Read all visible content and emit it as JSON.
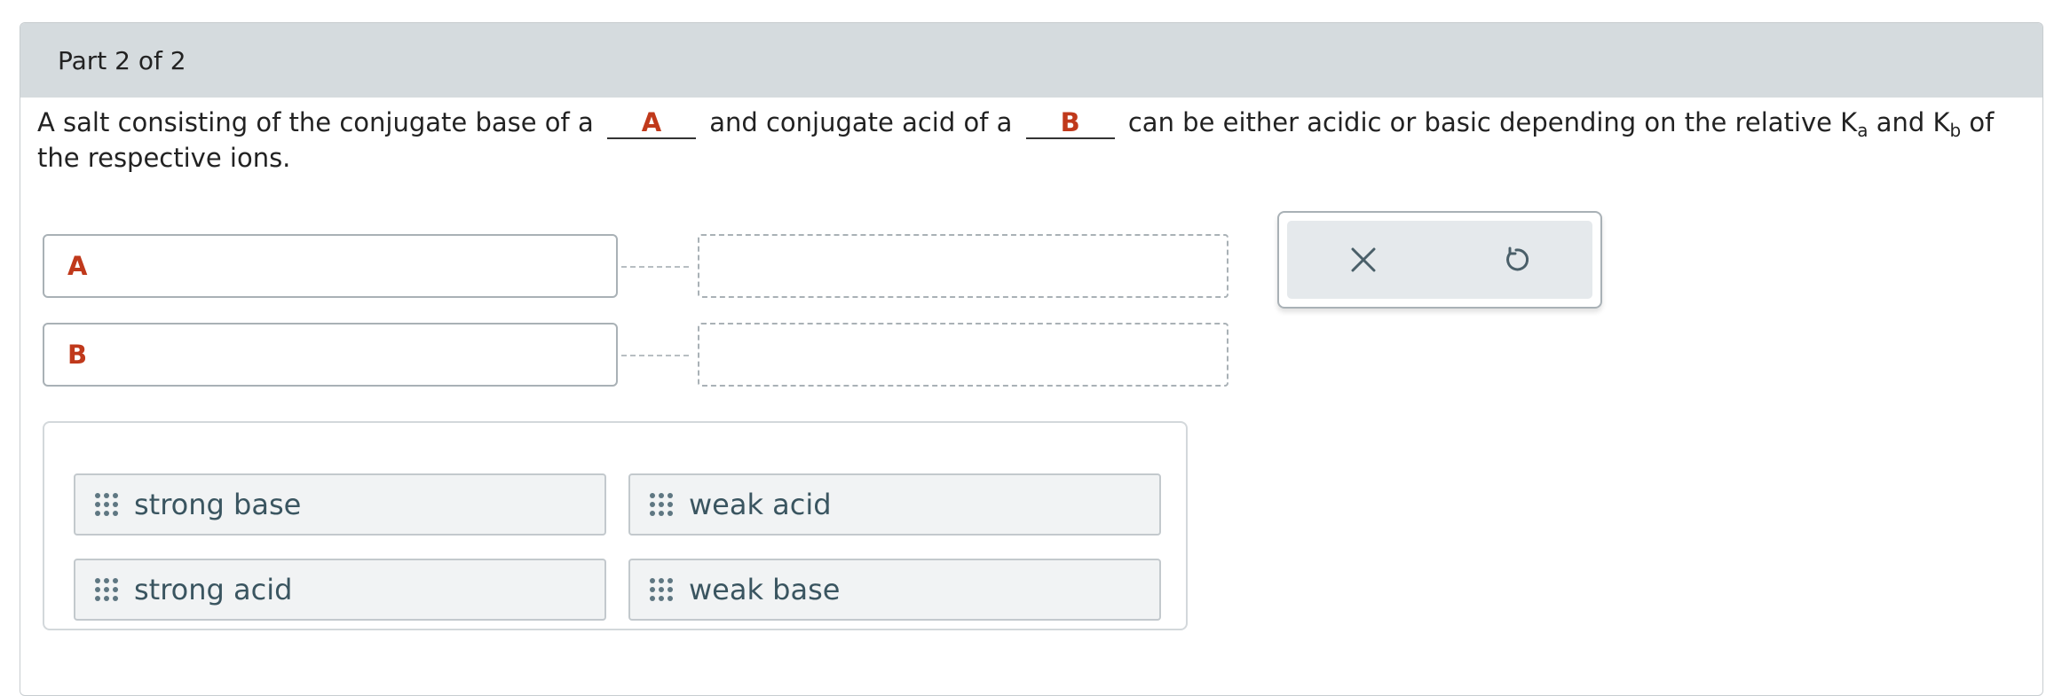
{
  "header": {
    "title": "Part 2 of 2"
  },
  "question": {
    "text_1": "A salt consisting of the conjugate base of a",
    "blank_a": "A",
    "text_2": "and conjugate acid of a",
    "blank_b": "B",
    "text_3": "can be either acidic or basic depending on the relative K",
    "ka_sub": "a",
    "text_4": "and K",
    "kb_sub": "b",
    "text_5": "of the respective ions."
  },
  "slots": [
    {
      "label": "A",
      "value": ""
    },
    {
      "label": "B",
      "value": ""
    }
  ],
  "tools": {
    "clear_icon": "close-icon",
    "reset_icon": "undo-icon"
  },
  "answer_bank": [
    {
      "label": "strong base"
    },
    {
      "label": "weak acid"
    },
    {
      "label": "strong acid"
    },
    {
      "label": "weak base"
    }
  ],
  "colors": {
    "accent_red": "#c0391b",
    "tile_text": "#3a5560",
    "header_bg": "#d5dbde"
  }
}
